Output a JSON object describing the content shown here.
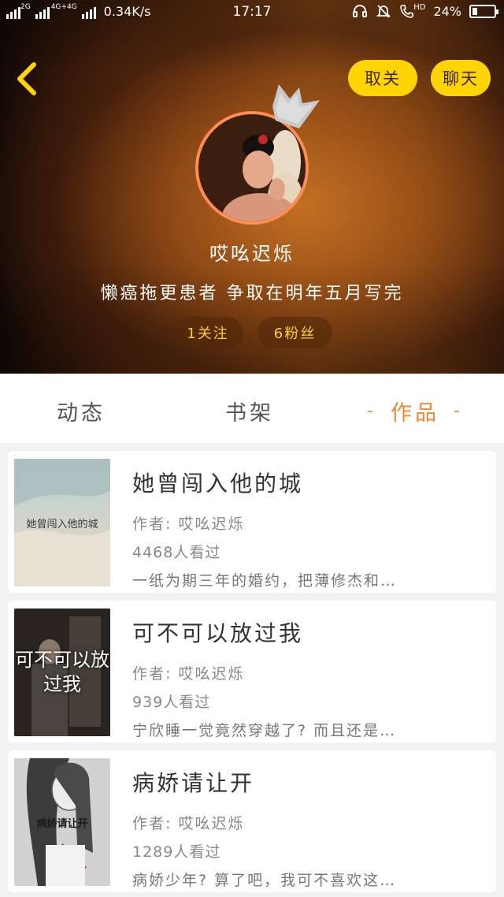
{
  "status_bar": {
    "network_left": "2G",
    "network_right": "4G+4G",
    "speed": "0.34K/s",
    "time": "17:17",
    "hd": "HD",
    "battery": "24%",
    "battery_level": 0.24
  },
  "header": {
    "back_icon": "chevron-left-icon",
    "unfollow_label": "取关",
    "chat_label": "聊天",
    "username": "哎吆迟烁",
    "bio": "懒癌拖更患者 争取在明年五月写完",
    "following": "1关注",
    "fans": "6粉丝",
    "accent": "#ffd400",
    "avatar_border": "#ff8d54"
  },
  "tabs": [
    {
      "label": "动态"
    },
    {
      "label": "书架"
    },
    {
      "label": "作品",
      "active": true,
      "decoration": "-"
    }
  ],
  "books": [
    {
      "cover_text": "她曾闯入他的城",
      "title": "她曾闯入他的城",
      "author": "作者: 哎吆迟烁",
      "views": "4468人看过",
      "desc": "一纸为期三年的婚约，把薄修杰和…"
    },
    {
      "cover_text": "可不可以放过我",
      "title": "可不可以放过我",
      "author": "作者: 哎吆迟烁",
      "views": "939人看过",
      "desc": "宁欣睡一觉竟然穿越了? 而且还是…"
    },
    {
      "cover_text": "病娇请让开",
      "title": "病娇请让开",
      "author": "作者: 哎吆迟烁",
      "views": "1289人看过",
      "desc": "病娇少年? 算了吧，我可不喜欢这…"
    }
  ]
}
